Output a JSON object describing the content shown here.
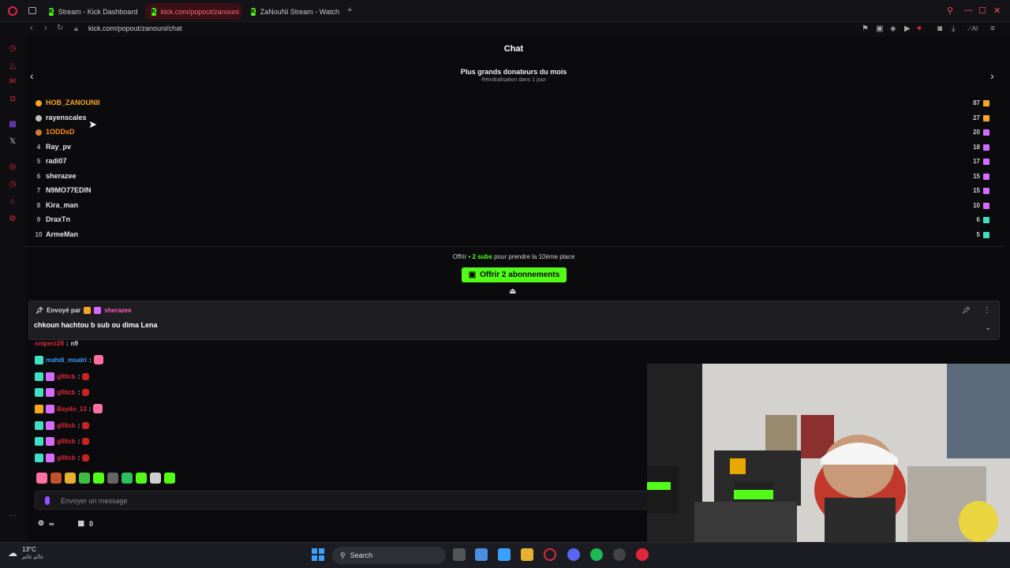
{
  "browser": {
    "tabs": [
      {
        "label": "Stream - Kick Dashboard",
        "active": false
      },
      {
        "label": "kick.com/popout/zanouni",
        "active": true
      },
      {
        "label": "ZaNouNi Stream - Watch L",
        "active": false
      }
    ],
    "url": "kick.com/popout/zanouni/chat",
    "ai_label": "AI"
  },
  "chat": {
    "title": "Chat",
    "leaderboard": {
      "title": "Plus grands donateurs du mois",
      "subtitle": "Réinitialisation dans 1 jour",
      "entries": [
        {
          "rank": "",
          "name": "HOB_ZANOUNII",
          "count": "87"
        },
        {
          "rank": "",
          "name": "rayenscales",
          "count": "27"
        },
        {
          "rank": "",
          "name": "1ODDxD",
          "count": "20"
        },
        {
          "rank": "4",
          "name": "Ray_pv",
          "count": "18"
        },
        {
          "rank": "5",
          "name": "radi07",
          "count": "17"
        },
        {
          "rank": "6",
          "name": "sherazee",
          "count": "15"
        },
        {
          "rank": "7",
          "name": "N9MO77EDIN",
          "count": "15"
        },
        {
          "rank": "8",
          "name": "Kira_man",
          "count": "10"
        },
        {
          "rank": "9",
          "name": "DraxTn",
          "count": "6"
        },
        {
          "rank": "10",
          "name": "ArmeMan",
          "count": "5"
        }
      ]
    },
    "offer": {
      "prefix": "Offrir",
      "highlight": "2 subs",
      "suffix": "pour prendre la 10ème place",
      "button_label": "Offrir 2 abonnements"
    },
    "pinned": {
      "sent_by_label": "Envoyé par",
      "user": "sherazee",
      "message": "chkoun hachtou b sub ou dima Lena"
    },
    "messages": [
      {
        "user": "sniperz28",
        "text": "n9",
        "user_color": "#e0283c"
      },
      {
        "user": "mahdi_msatri",
        "text": "",
        "user_color": "#3b9bff"
      },
      {
        "user": "gllltcb",
        "text": "",
        "user_color": "#e0283c"
      },
      {
        "user": "gllltcb",
        "text": "",
        "user_color": "#e0283c"
      },
      {
        "user": "Baydo_13",
        "text": "",
        "user_color": "#e0283c"
      },
      {
        "user": "gllltcb",
        "text": "",
        "user_color": "#e0283c"
      },
      {
        "user": "gllltcb",
        "text": "",
        "user_color": "#e0283c"
      },
      {
        "user": "gllltcb",
        "text": "",
        "user_color": "#e0283c"
      }
    ],
    "input_placeholder": "Envoyer un message",
    "footer": {
      "points": "0"
    }
  },
  "taskbar": {
    "temperature": "13°C",
    "location": "عالم غائم",
    "search_label": "Search"
  },
  "colors": {
    "kick_green": "#53fc18",
    "gold": "#f5a623",
    "silver": "#c0c0c0",
    "bronze": "#cd7f32",
    "accent_red": "#e0283c"
  }
}
